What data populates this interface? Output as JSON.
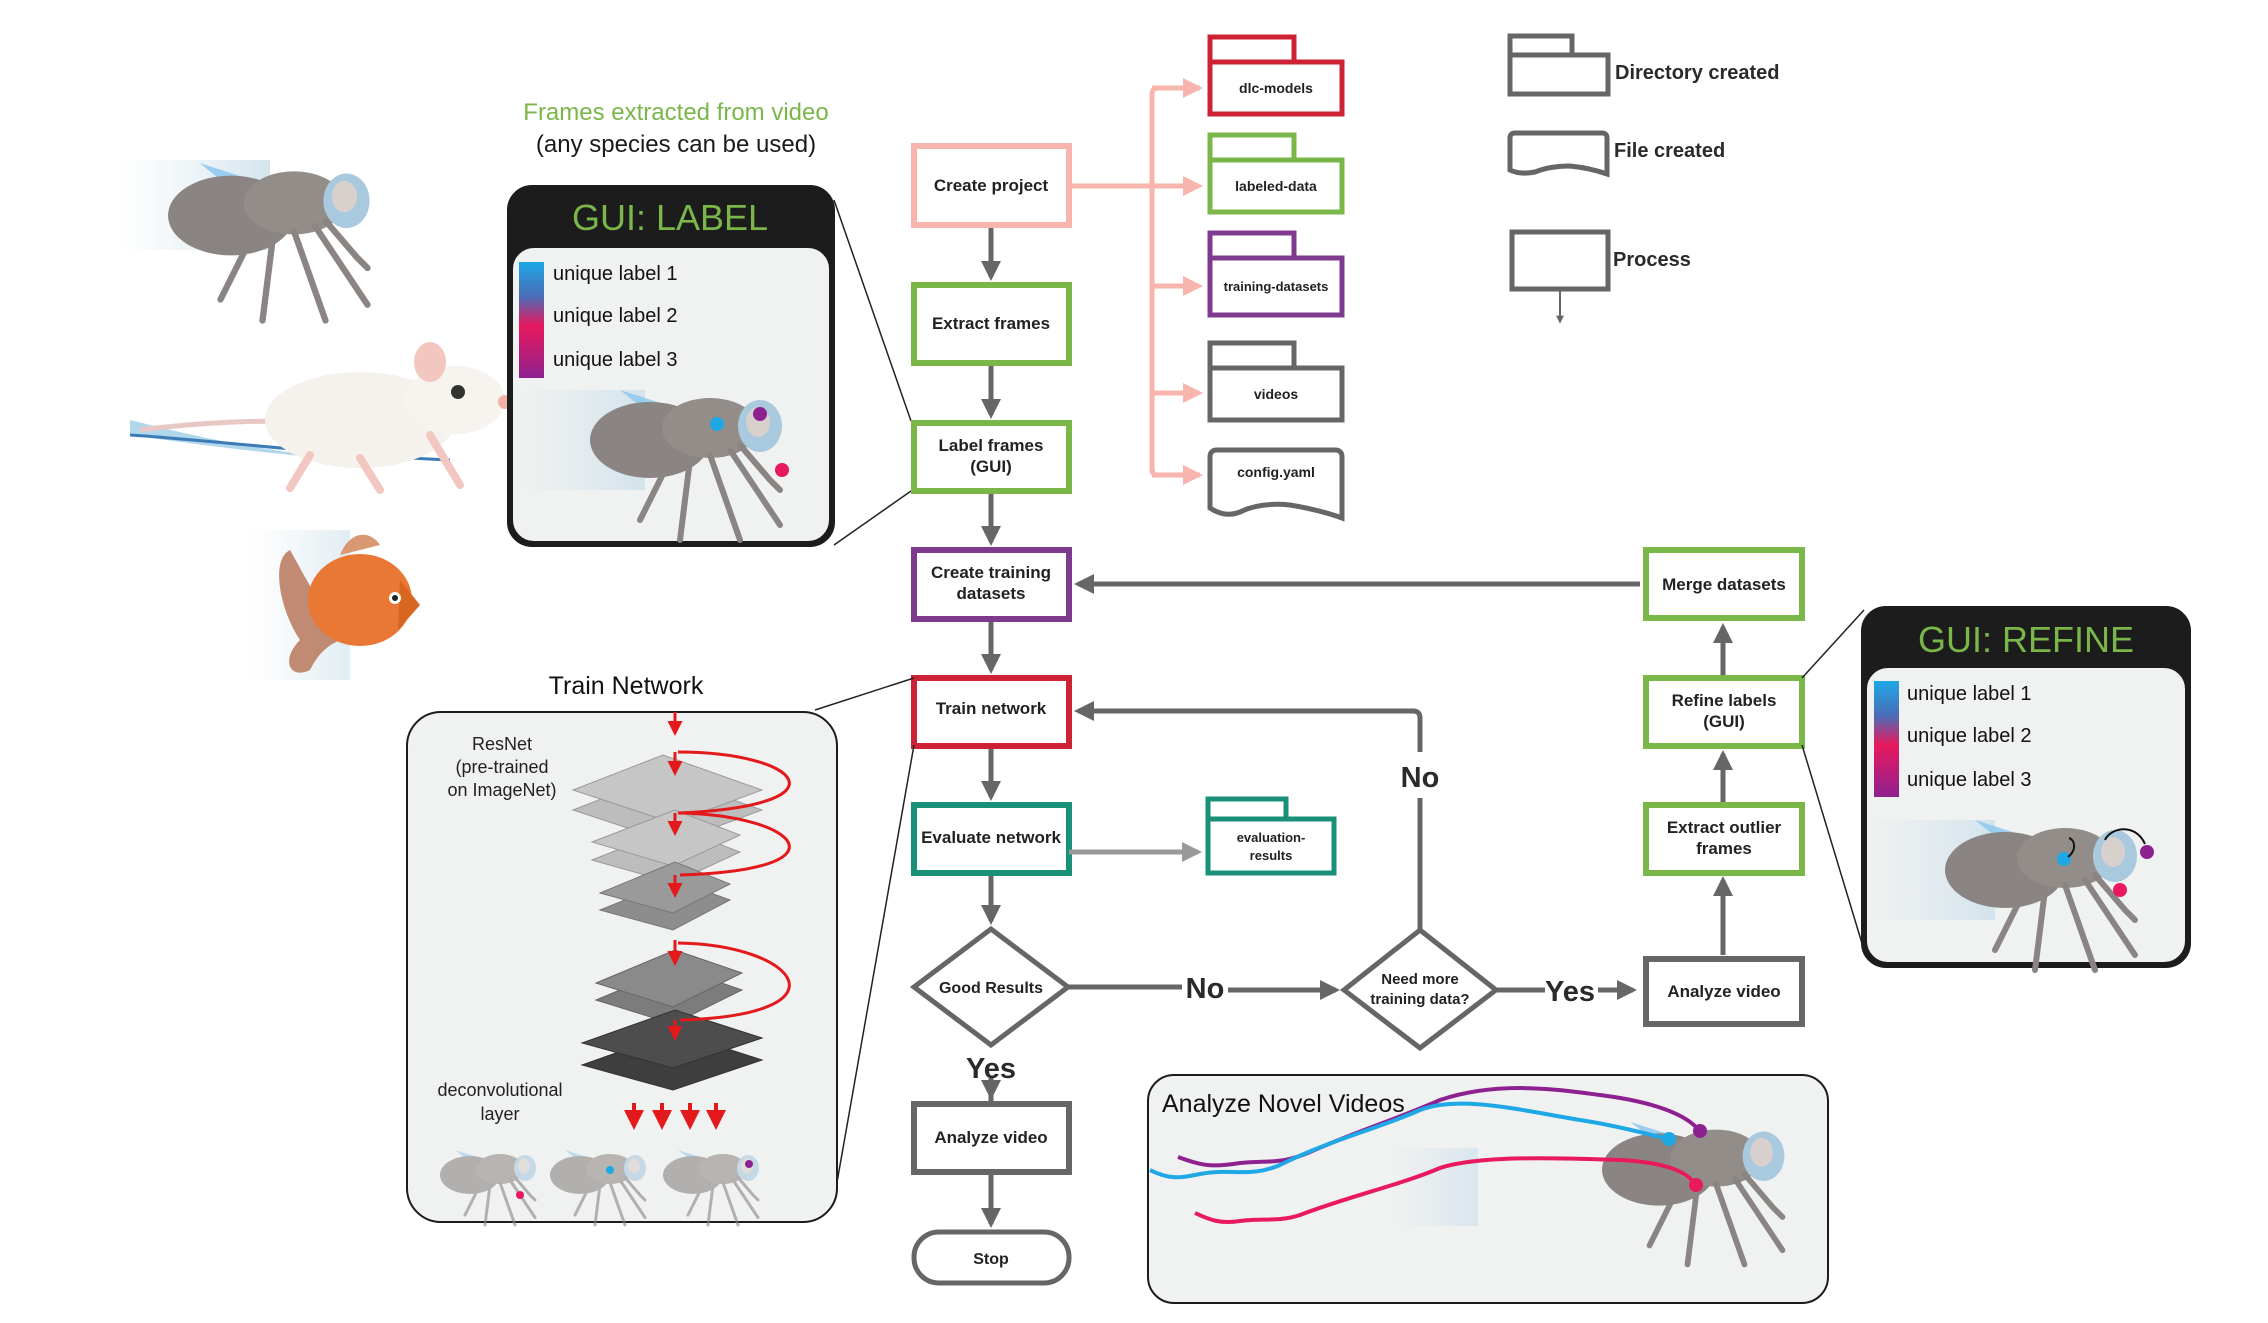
{
  "caption": {
    "line1": "Frames extracted from video",
    "line2": "(any species can be used)"
  },
  "species": [
    "fly",
    "mouse",
    "goldfish"
  ],
  "colors": {
    "create": "#f7b5ad",
    "green": "#7ab648",
    "purple": "#7e3a8e",
    "red": "#cc2233",
    "teal": "#1a9078",
    "gray": "#666666",
    "label1": "#1ea8e6",
    "label2": "#e8195e",
    "label3": "#8e2190",
    "panel_bg": "#f0f1f1",
    "panel_header": "#1c1c1c"
  },
  "flow": {
    "create_project": "Create project",
    "extract_frames": "Extract frames",
    "label_frames_1": "Label frames",
    "label_frames_2": "(GUI)",
    "create_training_1": "Create training",
    "create_training_2": "datasets",
    "train_network": "Train network",
    "evaluate_network": "Evaluate network",
    "good_results": "Good Results",
    "analyze_video": "Analyze video",
    "stop": "Stop",
    "need_more_1": "Need more",
    "need_more_2": "training data?",
    "analyze_video_right": "Analyze video",
    "extract_outlier_1": "Extract outlier",
    "extract_outlier_2": "frames",
    "refine_labels_1": "Refine labels",
    "refine_labels_2": "(GUI)",
    "merge_datasets": "Merge datasets"
  },
  "edge_labels": {
    "no_good": "No",
    "yes_good": "Yes",
    "yes_need": "Yes",
    "no_need": "No"
  },
  "folders": {
    "dlc_models": "dlc-models",
    "labeled_data": "labeled-data",
    "training_datasets": "training-datasets",
    "videos": "videos",
    "config": "config.yaml",
    "evaluation_1": "evaluation-",
    "evaluation_2": "results"
  },
  "legend": {
    "directory": "Directory created",
    "file": "File created",
    "process": "Process"
  },
  "gui_label": {
    "title": "GUI: LABEL",
    "labels": [
      "unique label 1",
      "unique label 2",
      "unique label 3"
    ]
  },
  "gui_refine": {
    "title": "GUI: REFINE",
    "labels": [
      "unique label 1",
      "unique label 2",
      "unique label 3"
    ]
  },
  "train_panel": {
    "heading": "Train Network",
    "resnet_1": "ResNet",
    "resnet_2": "(pre-trained",
    "resnet_3": "on ImageNet)",
    "deconv_1": "deconvolutional",
    "deconv_2": "layer"
  },
  "novel_panel": {
    "heading": "Analyze Novel Videos"
  }
}
